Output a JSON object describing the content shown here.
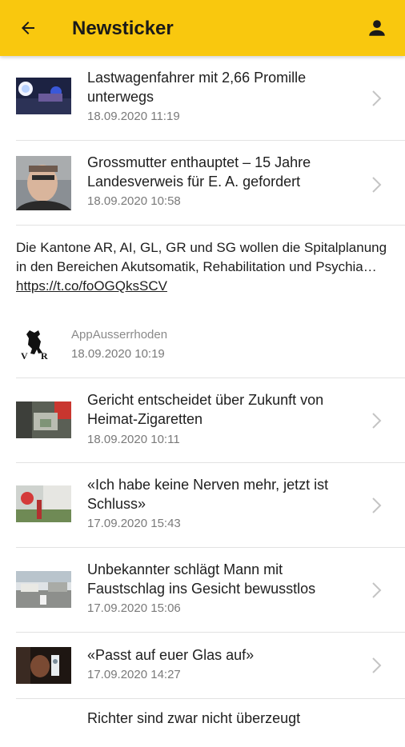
{
  "appbar": {
    "title": "Newsticker",
    "back_icon": "arrow-left-icon",
    "profile_icon": "person-icon",
    "background": "#f9c80e"
  },
  "feed": {
    "items": [
      {
        "type": "news",
        "headline": "Lastwagenfahrer mit 2,66 Promille unterwegs",
        "date": "18.09.2020 11:19"
      },
      {
        "type": "news",
        "headline": "Grossmutter enthauptet – 15 Jahre Landesverweis für E. A. gefordert",
        "date": "18.09.2020 10:58"
      },
      {
        "type": "tweet",
        "text": "Die Kantone AR, AI, GL, GR und SG wollen die Spitalplanung in den Bereichen Akutsomatik, Rehabilitation und Psychia…",
        "link": "https://t.co/foOGQksSCV",
        "author": "AppAusserrhoden",
        "date": "18.09.2020 10:19"
      },
      {
        "type": "news",
        "headline": "Gericht entscheidet über Zukunft von Heimat-Zigaretten",
        "date": "18.09.2020 10:11"
      },
      {
        "type": "news",
        "headline": "«Ich habe keine Nerven mehr, jetzt ist Schluss»",
        "date": "17.09.2020 15:43"
      },
      {
        "type": "news",
        "headline": "Unbekannter schlägt Mann mit Faustschlag ins Gesicht bewusstlos",
        "date": "17.09.2020 15:06"
      },
      {
        "type": "news",
        "headline": "«Passt auf euer Glas auf»",
        "date": "17.09.2020 14:27"
      },
      {
        "type": "news",
        "headline": "Richter sind zwar nicht überzeugt"
      }
    ]
  }
}
